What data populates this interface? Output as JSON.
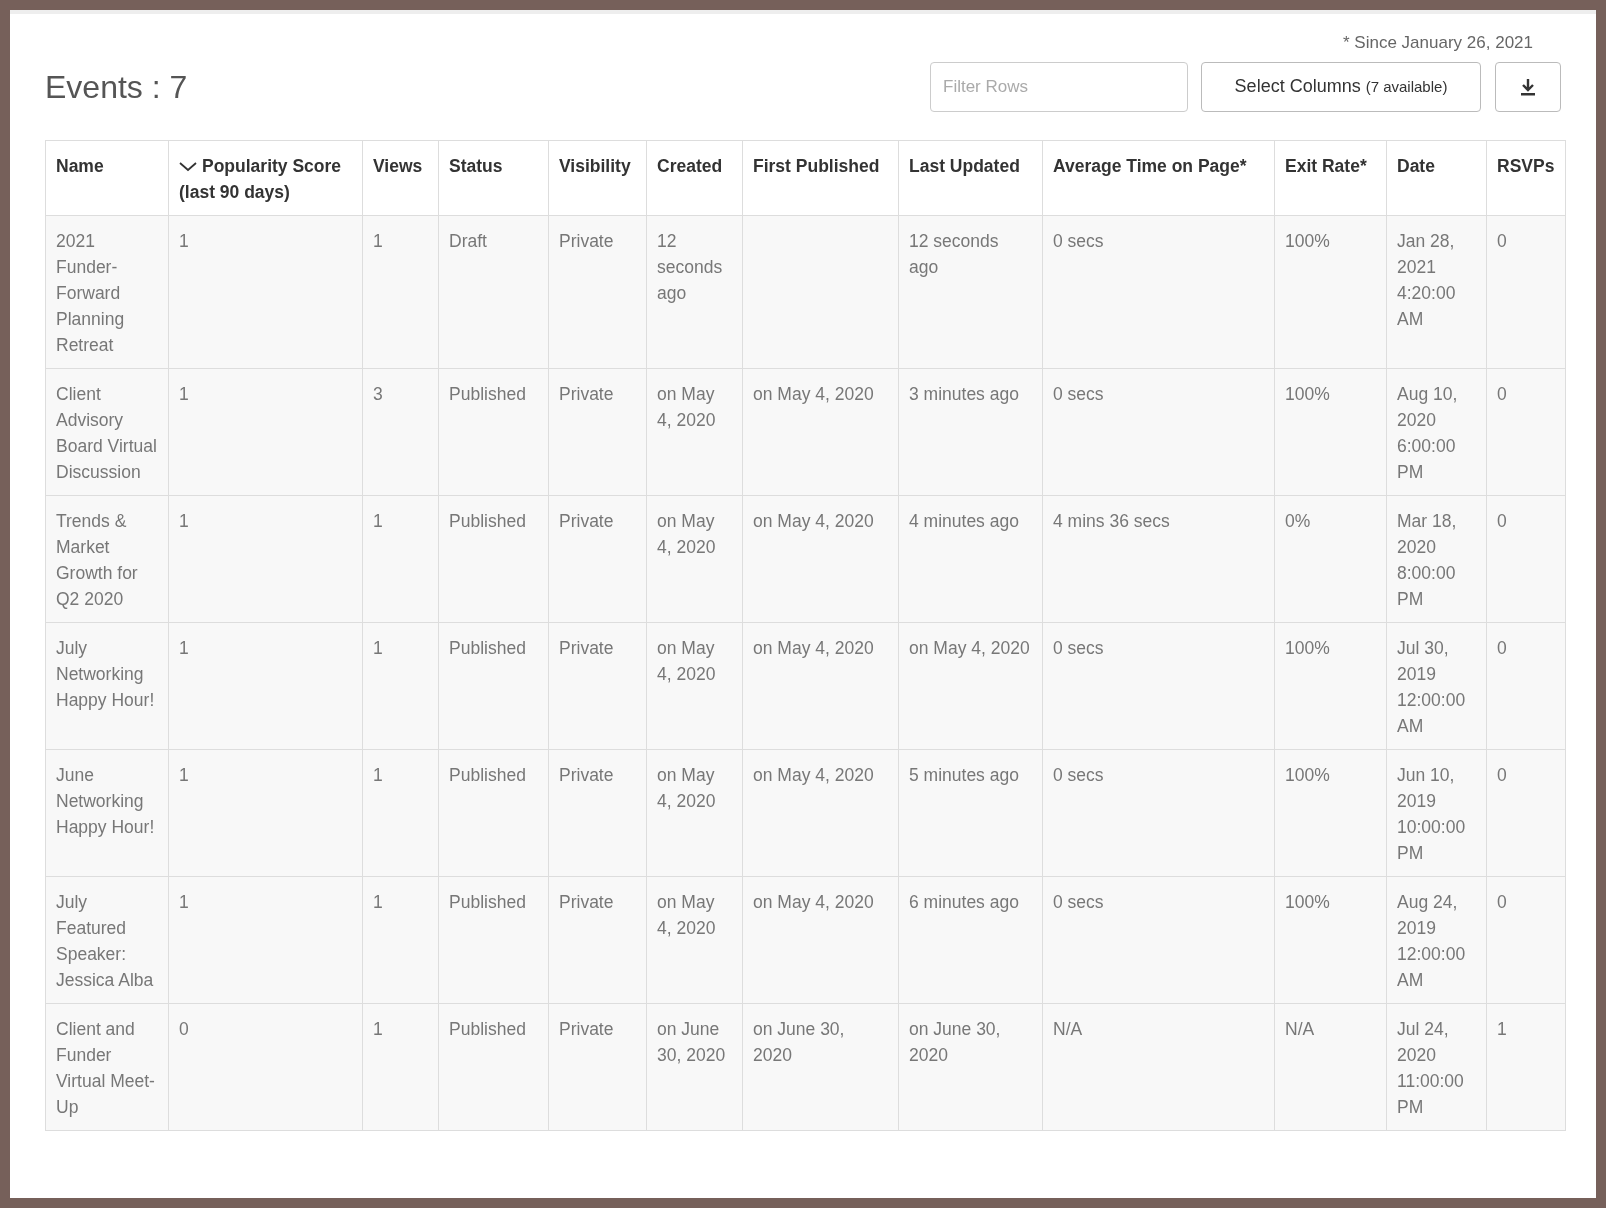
{
  "note": "* Since January 26, 2021",
  "title": "Events : 7",
  "filter": {
    "placeholder": "Filter Rows"
  },
  "select_columns": {
    "label": "Select Columns",
    "count": "(7 available)"
  },
  "table": {
    "columns": [
      {
        "label": "Name",
        "sorted": false
      },
      {
        "label": "Popularity Score (last 90 days)",
        "sorted": true
      },
      {
        "label": "Views",
        "sorted": false
      },
      {
        "label": "Status",
        "sorted": false
      },
      {
        "label": "Visibility",
        "sorted": false
      },
      {
        "label": "Created",
        "sorted": false
      },
      {
        "label": "First Published",
        "sorted": false
      },
      {
        "label": "Last Updated",
        "sorted": false
      },
      {
        "label": "Average Time on Page*",
        "sorted": false
      },
      {
        "label": "Exit Rate*",
        "sorted": false
      },
      {
        "label": "Date",
        "sorted": false
      },
      {
        "label": "RSVPs",
        "sorted": false
      }
    ],
    "rows": [
      [
        "2021 Funder-Forward Planning Retreat",
        "1",
        "1",
        "Draft",
        "Private",
        "12 seconds ago",
        null,
        "12 seconds ago",
        "0 secs",
        "100%",
        "Jan 28, 2021 4:20:00 AM",
        "0"
      ],
      [
        "Client Advisory Board Virtual Discussion",
        "1",
        "3",
        "Published",
        "Private",
        "on May 4, 2020",
        "on May 4, 2020",
        "3 minutes ago",
        "0 secs",
        "100%",
        "Aug 10, 2020 6:00:00 PM",
        "0"
      ],
      [
        "Trends & Market Growth for Q2 2020",
        "1",
        "1",
        "Published",
        "Private",
        "on May 4, 2020",
        "on May 4, 2020",
        "4 minutes ago",
        "4 mins 36 secs",
        "0%",
        "Mar 18, 2020 8:00:00 PM",
        "0"
      ],
      [
        "July Networking Happy Hour!",
        "1",
        "1",
        "Published",
        "Private",
        "on May 4, 2020",
        "on May 4, 2020",
        "on May 4, 2020",
        "0 secs",
        "100%",
        "Jul 30, 2019 12:00:00 AM",
        "0"
      ],
      [
        "June Networking Happy Hour!",
        "1",
        "1",
        "Published",
        "Private",
        "on May 4, 2020",
        "on May 4, 2020",
        "5 minutes ago",
        "0 secs",
        "100%",
        "Jun 10, 2019 10:00:00 PM",
        "0"
      ],
      [
        "July Featured Speaker: Jessica Alba",
        "1",
        "1",
        "Published",
        "Private",
        "on May 4, 2020",
        "on May 4, 2020",
        "6 minutes ago",
        "0 secs",
        "100%",
        "Aug 24, 2019 12:00:00 AM",
        "0"
      ],
      [
        "Client and Funder Virtual Meet-Up",
        "0",
        "1",
        "Published",
        "Private",
        "on June 30, 2020",
        "on June 30, 2020",
        "on June 30, 2020",
        "N/A",
        "N/A",
        "Jul 24, 2020 11:00:00 PM",
        "1"
      ]
    ]
  }
}
